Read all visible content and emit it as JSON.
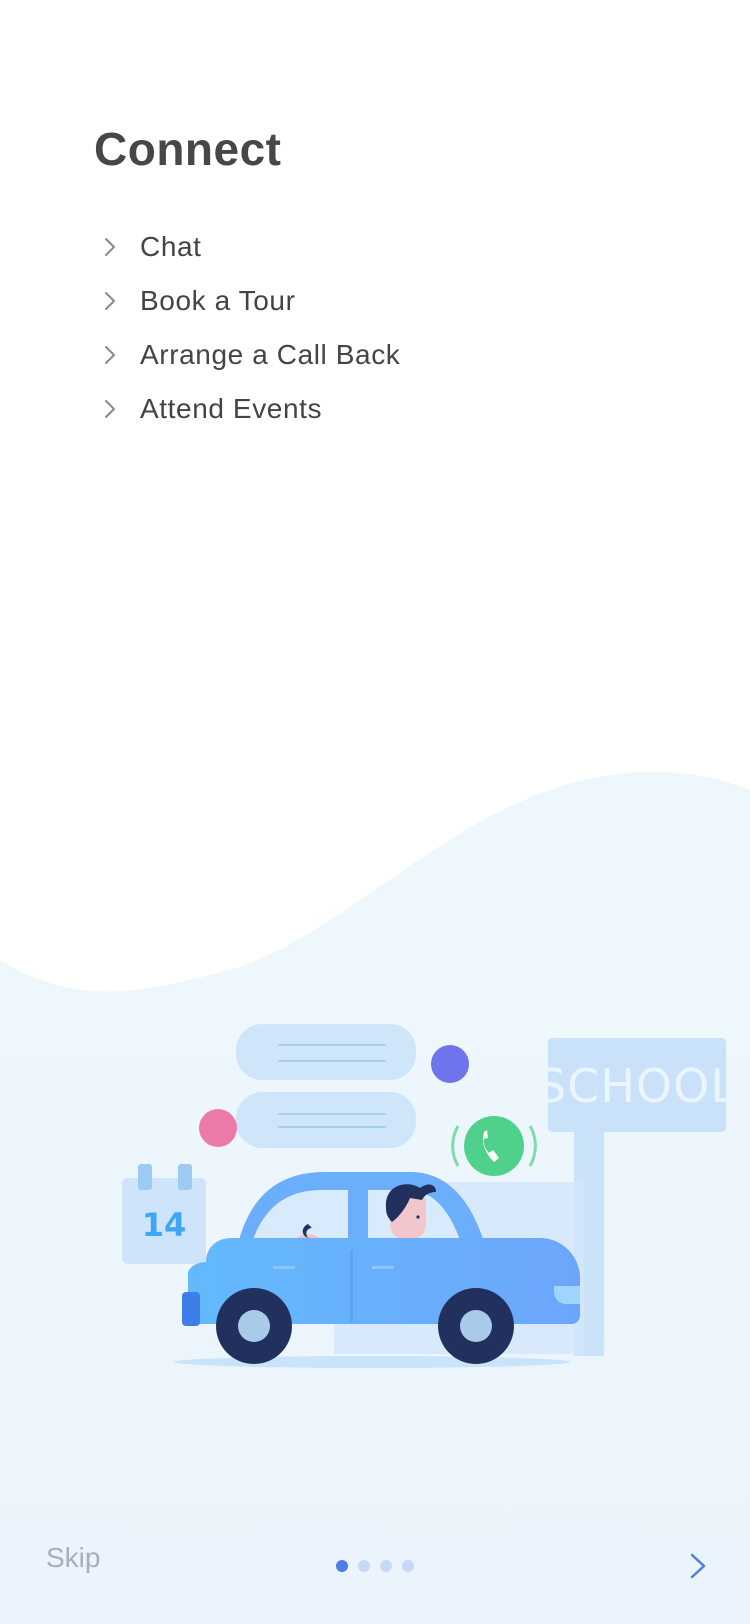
{
  "header": {
    "title": "Connect"
  },
  "menu": {
    "items": [
      {
        "label": "Chat"
      },
      {
        "label": "Book a Tour"
      },
      {
        "label": "Arrange a Call Back"
      },
      {
        "label": "Attend Events"
      }
    ]
  },
  "illustration": {
    "sign_text": "SCHOOL",
    "calendar_day": "14",
    "colors": {
      "background_wave": "#eef7fc",
      "car_body": "#6aaefc",
      "wheel": "#22305e",
      "phone_bubble": "#4fd18b",
      "pink_dot": "#ec7aa8",
      "purple_dot": "#6f73ec"
    }
  },
  "footer": {
    "skip_label": "Skip",
    "page_count": 4,
    "active_page": 1
  },
  "colors": {
    "accent": "#4a7ee6",
    "title": "#474747",
    "text": "#444444",
    "muted": "#a6b0ba"
  }
}
